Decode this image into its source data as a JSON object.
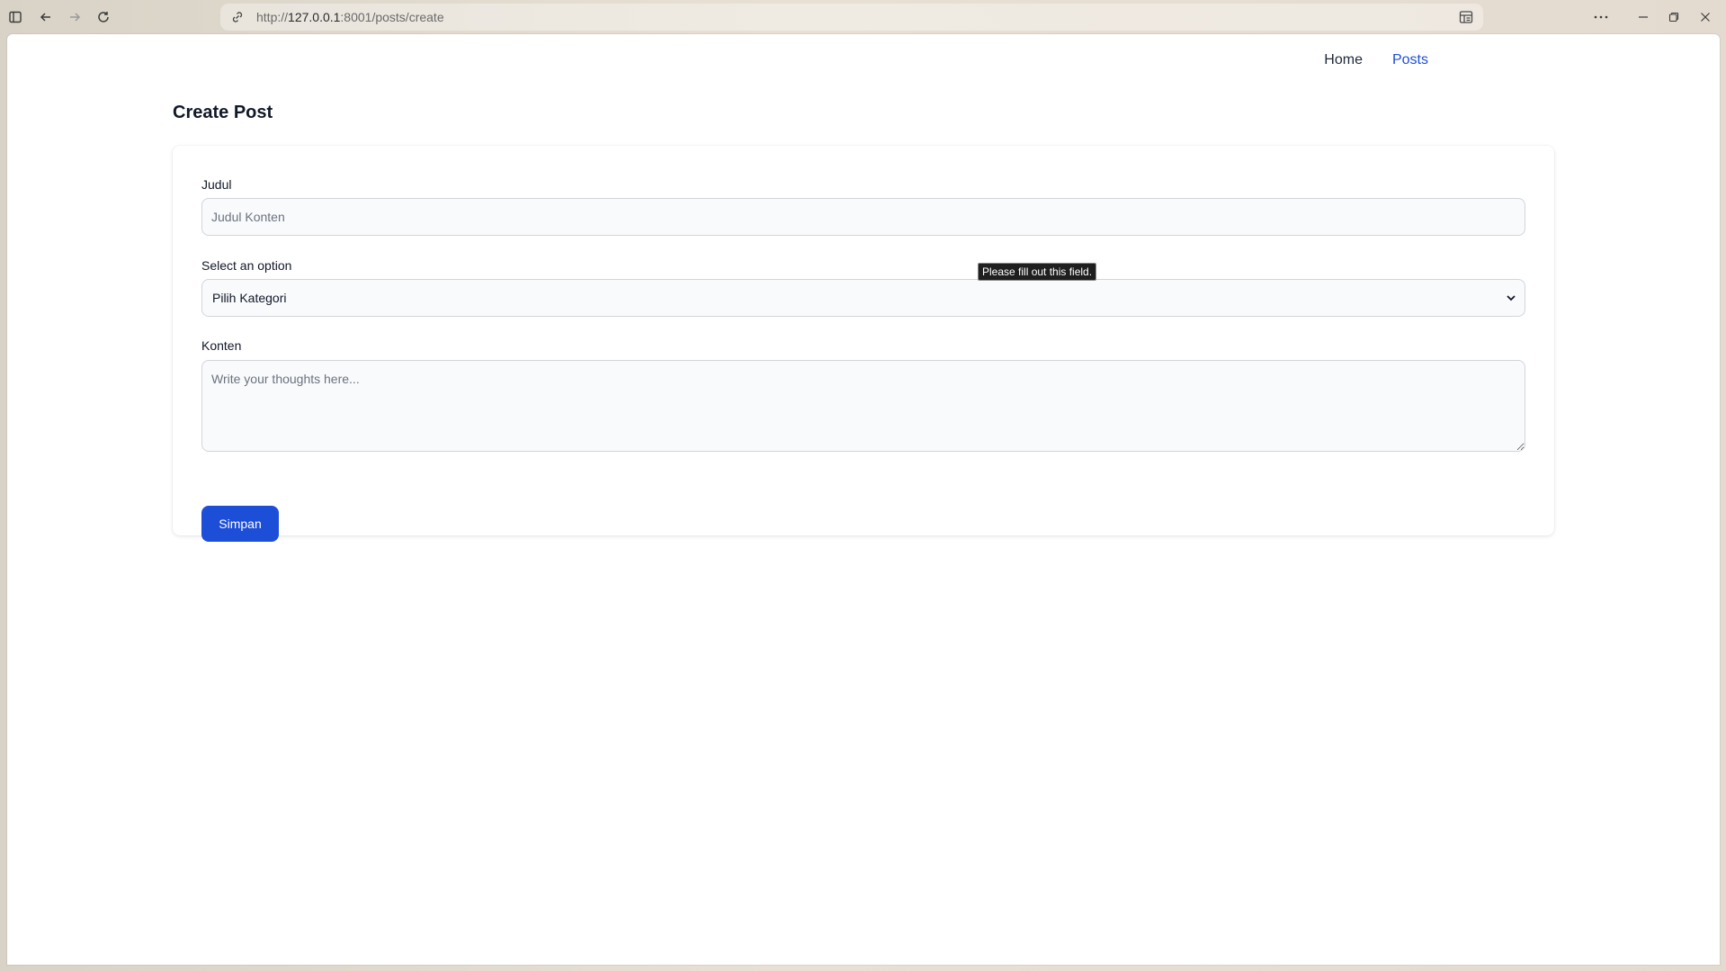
{
  "browser": {
    "url_scheme": "http://",
    "url_host": "127.0.0.1",
    "url_rest": ":8001/posts/create"
  },
  "nav": {
    "home": "Home",
    "posts": "Posts"
  },
  "page": {
    "title": "Create Post"
  },
  "form": {
    "title_label": "Judul",
    "title_placeholder": "Judul Konten",
    "title_value": "",
    "category_label": "Select an option",
    "category_selected": "Pilih Kategori",
    "content_label": "Konten",
    "content_placeholder": "Write your thoughts here...",
    "submit_label": "Simpan"
  },
  "tooltip": {
    "text": "Please fill out this field."
  },
  "icons": {
    "sidebar": "sidebar-icon",
    "back": "back-arrow-icon",
    "forward": "forward-arrow-icon",
    "reload": "reload-icon",
    "site_info": "link-icon",
    "reader": "reader-view-icon",
    "more": "more-icon",
    "minimize": "minimize-icon",
    "restore": "restore-icon",
    "close": "close-icon"
  },
  "colors": {
    "accent": "#1d4ed8",
    "text": "#111827",
    "input_bg": "#f9fafb",
    "input_border": "#d1d5db"
  }
}
